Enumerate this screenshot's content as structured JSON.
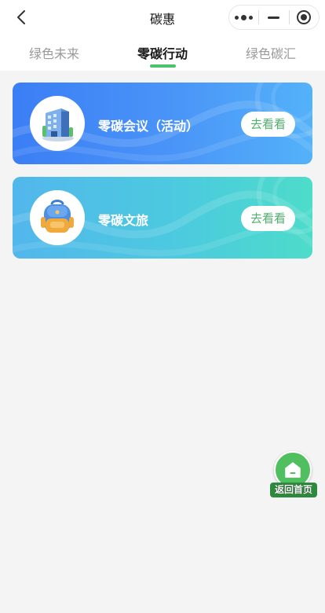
{
  "navbar": {
    "title": "碳惠",
    "back_icon": "chevron-left-icon",
    "more_icon": "more-dots-icon",
    "minimize_icon": "minus-icon",
    "close_icon": "target-circle-icon"
  },
  "tabs": [
    {
      "label": "绿色未来",
      "active": false
    },
    {
      "label": "零碳行动",
      "active": true
    },
    {
      "label": "绿色碳汇",
      "active": false
    }
  ],
  "cards": [
    {
      "title": "零碳会议（活动）",
      "button_label": "去看看",
      "icon": "office-building-icon"
    },
    {
      "title": "零碳文旅",
      "button_label": "去看看",
      "icon": "backpack-icon"
    }
  ],
  "floating_home": {
    "label": "返回首页",
    "icon": "home-icon"
  },
  "colors": {
    "accent_green": "#4cc26a",
    "card1_gradient": [
      "#3b7ef5",
      "#54b2f9"
    ],
    "card2_gradient": [
      "#52b7ec",
      "#4ddcca"
    ],
    "home_green": "#4fbf5f"
  }
}
